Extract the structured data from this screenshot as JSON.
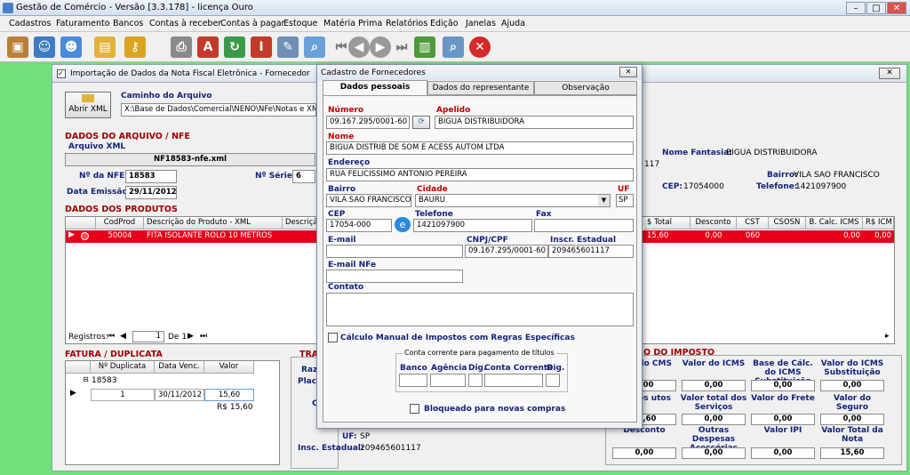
{
  "app": {
    "title": "Gestão de Comércio - Versão [3.3.178] - licença Ouro"
  },
  "menu": [
    "Cadastros",
    "Faturamento",
    "Bancos",
    "Contas à receber",
    "Contas à pagar",
    "Estoque",
    "Matéria Prima",
    "Relatórios",
    "Edição",
    "Janelas",
    "Ajuda"
  ],
  "import_win": {
    "title": "Importação de Dados da Nota Fiscal Eletrônica - Fornecedor",
    "open_xml": "Abrir XML",
    "path_label": "Caminho do Arquivo",
    "path_value": "X:\\Base de Dados\\Comercial\\NENO\\NFe\\Notas e XML rece",
    "sec_dados": "DADOS DO ARQUIVO / NFE",
    "arquivo_label": "Arquivo XML",
    "arquivo_value": "NF18583-nfe.xml",
    "nfe_label": "Nº da NFE:",
    "nfe_value": "18583",
    "serie_label": "Nº Série:",
    "serie_value": "6",
    "emissao_label": "Data Emissão:",
    "emissao_value": "29/11/2012",
    "fantasia_label": "Nome Fantasia:",
    "fantasia_value": "BIGUA DISTRIBUIDORA",
    "frag117": "117",
    "bairro_label": "Bairro:",
    "bairro_value": "VILA SAO FRANCISCO",
    "cep_label": "CEP:",
    "cep_value": "17054000",
    "tel_label": "Telefone:",
    "tel_value": "1421097900",
    "sec_produtos": "DADOS DOS PRODUTOS",
    "prod_headers_left": [
      "CodProd",
      "Descrição do Produto - XML",
      "Descriçã"
    ],
    "prod_headers_right": [
      "$ Total",
      "Desconto",
      "CST",
      "CSOSN",
      "B. Calc. ICMS",
      "R$ ICM"
    ],
    "prod_row_left": [
      "50004",
      "FITA ISOLANTE ROLO 10 METROS"
    ],
    "prod_row_right": [
      "15,60",
      "0,00",
      "060",
      "",
      "0,00",
      "0,00"
    ],
    "registros_label": "Registros:",
    "registros_value": "1",
    "registros_of": "De 1",
    "sec_fatura": "FATURA / DUPLICATA",
    "fat_headers": [
      "Nº Duplicata",
      "Data Venc.",
      "Valor"
    ],
    "fat_group": "18583",
    "fat_row": [
      "1",
      "30/11/2012",
      "15,60"
    ],
    "fat_total": "R$ 15,60",
    "tra": "TRA",
    "raz": "Raz",
    "plac": "Plac",
    "c": "C",
    "uf_label": "UF:",
    "uf_value": "SP",
    "insc_label": "Insc. Estadual:",
    "insc_value": "209465601117",
    "sec_imposto": "O DO IMPOSTO",
    "imp_labels": [
      "Cálculo CMS",
      "Valor do ICMS",
      "Base de Cálc. do ICMS Substituição",
      "Valor do ICMS Substituição",
      "tal dos utos",
      "Valor total dos Serviços",
      "Valor do Frete",
      "Valor do Seguro",
      "Desconto",
      "Outras Despesas Acessórias",
      "Valor IPI",
      "Valor Total da Nota"
    ],
    "imp_values": [
      "0,00",
      "0,00",
      "0,00",
      "0,00",
      "15,60",
      "0,00",
      "0,00",
      "0,00",
      "0,00",
      "0,00",
      "0,00",
      "15,60"
    ]
  },
  "dialog": {
    "title": "Cadastro de Fornecedores",
    "tabs": [
      "Dados pessoais",
      "Dados do representante",
      "Observação"
    ],
    "numero_label": "Número",
    "numero_value": "09.167.295/0001-60",
    "apelido_label": "Apelido",
    "apelido_value": "BIGUA DISTRIBUIDORA",
    "nome_label": "Nome",
    "nome_value": "BIGUA DISTRIB DE SOM E ACESS AUTOM LTDA",
    "endereco_label": "Endereço",
    "endereco_value": "RUA FELICISSIMO ANTONIO PEREIRA",
    "bairro_label": "Bairro",
    "bairro_value": "VILA SAO FRANCISCO",
    "cidade_label": "Cidade",
    "cidade_value": "BAURU",
    "uf_label": "UF",
    "uf_value": "SP",
    "cep_label": "CEP",
    "cep_value": "17054-000",
    "telefone_label": "Telefone",
    "telefone_value": "1421097900",
    "fax_label": "Fax",
    "fax_value": "",
    "email_label": "E-mail",
    "email_value": "",
    "cnpj_label": "CNPJ/CPF",
    "cnpj_value": "09.167.295/0001-60",
    "insc_label": "Inscr. Estadual",
    "insc_value": "209465601117",
    "emailnfe_label": "E-mail NFe",
    "contato_label": "Contato",
    "calc_label": "Cálculo Manual de Impostos com Regras Específicas",
    "conta_title": "Conta corrente para pagamento de títulos",
    "banco": "Banco",
    "agencia": "Agência",
    "dig": "Dig.",
    "conta": "Conta Corrente",
    "dig2": "Dig.",
    "bloq_label": "Bloqueado para novas compras"
  }
}
